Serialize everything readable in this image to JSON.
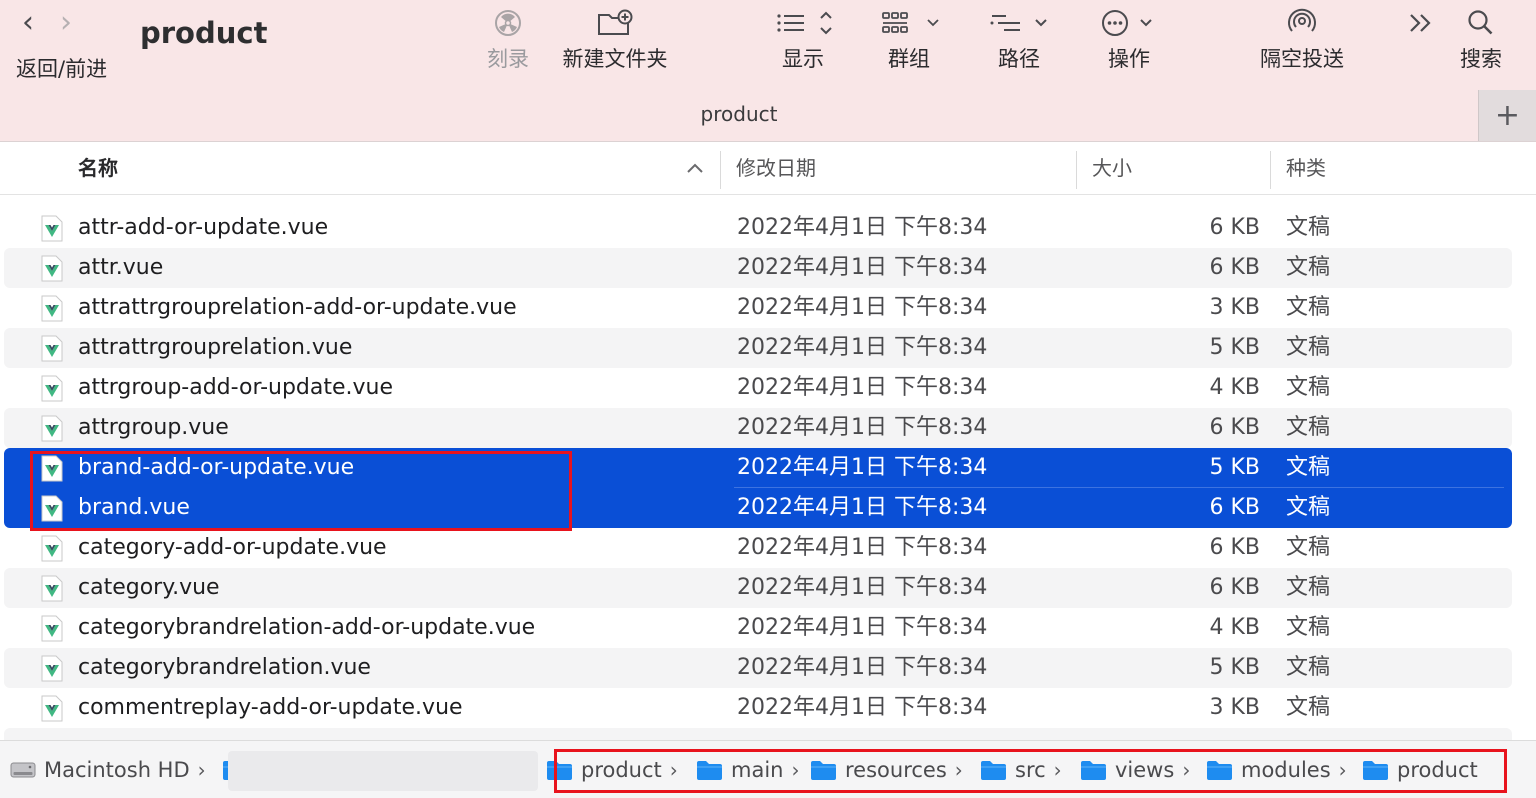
{
  "window": {
    "title": "product",
    "tab_title": "product",
    "tab_add": "+"
  },
  "toolbar": {
    "nav_label": "返回/前进",
    "back_glyph": "‹",
    "forward_glyph": "›",
    "buttons": [
      {
        "id": "burn",
        "label": "刻录",
        "icon": "burn-icon",
        "enabled": false
      },
      {
        "id": "new-folder",
        "label": "新建文件夹",
        "icon": "new-folder-icon",
        "enabled": true
      },
      {
        "id": "view",
        "label": "显示",
        "icon": "list-view-icon",
        "enabled": true
      },
      {
        "id": "group",
        "label": "群组",
        "icon": "group-icon",
        "enabled": true
      },
      {
        "id": "path",
        "label": "路径",
        "icon": "path-icon",
        "enabled": true
      },
      {
        "id": "action",
        "label": "操作",
        "icon": "ellipsis-circle-icon",
        "enabled": true
      },
      {
        "id": "airdrop",
        "label": "隔空投送",
        "icon": "airdrop-icon",
        "enabled": true
      },
      {
        "id": "more",
        "label": "",
        "icon": "chevron-double-right-icon",
        "enabled": true
      },
      {
        "id": "search",
        "label": "搜索",
        "icon": "search-icon",
        "enabled": true
      }
    ]
  },
  "columns": {
    "name": "名称",
    "date": "修改日期",
    "size": "大小",
    "kind": "种类",
    "sort_indicator": "ascending"
  },
  "files": [
    {
      "name": "attr-add-or-update.vue",
      "date": "2022年4月1日 下午8:34",
      "size": "6 KB",
      "kind": "文稿",
      "selected": false
    },
    {
      "name": "attr.vue",
      "date": "2022年4月1日 下午8:34",
      "size": "6 KB",
      "kind": "文稿",
      "selected": false
    },
    {
      "name": "attrattrgrouprelation-add-or-update.vue",
      "date": "2022年4月1日 下午8:34",
      "size": "3 KB",
      "kind": "文稿",
      "selected": false
    },
    {
      "name": "attrattrgrouprelation.vue",
      "date": "2022年4月1日 下午8:34",
      "size": "5 KB",
      "kind": "文稿",
      "selected": false
    },
    {
      "name": "attrgroup-add-or-update.vue",
      "date": "2022年4月1日 下午8:34",
      "size": "4 KB",
      "kind": "文稿",
      "selected": false
    },
    {
      "name": "attrgroup.vue",
      "date": "2022年4月1日 下午8:34",
      "size": "6 KB",
      "kind": "文稿",
      "selected": false
    },
    {
      "name": "brand-add-or-update.vue",
      "date": "2022年4月1日 下午8:34",
      "size": "5 KB",
      "kind": "文稿",
      "selected": true
    },
    {
      "name": "brand.vue",
      "date": "2022年4月1日 下午8:34",
      "size": "6 KB",
      "kind": "文稿",
      "selected": true
    },
    {
      "name": "category-add-or-update.vue",
      "date": "2022年4月1日 下午8:34",
      "size": "6 KB",
      "kind": "文稿",
      "selected": false
    },
    {
      "name": "category.vue",
      "date": "2022年4月1日 下午8:34",
      "size": "6 KB",
      "kind": "文稿",
      "selected": false
    },
    {
      "name": "categorybrandrelation-add-or-update.vue",
      "date": "2022年4月1日 下午8:34",
      "size": "4 KB",
      "kind": "文稿",
      "selected": false
    },
    {
      "name": "categorybrandrelation.vue",
      "date": "2022年4月1日 下午8:34",
      "size": "5 KB",
      "kind": "文稿",
      "selected": false
    },
    {
      "name": "commentreplay-add-or-update.vue",
      "date": "2022年4月1日 下午8:34",
      "size": "3 KB",
      "kind": "文稿",
      "selected": false
    }
  ],
  "pathbar": {
    "disk": "Macintosh HD",
    "folders": [
      "product",
      "main",
      "resources",
      "src",
      "views",
      "modules",
      "product"
    ],
    "separator": "›"
  },
  "colors": {
    "toolbar_bg": "#f9e6e7",
    "selection": "#0a4fd6",
    "annotation": "#e8131d",
    "folder": "#1e8cf0",
    "vue_green": "#41b883"
  }
}
